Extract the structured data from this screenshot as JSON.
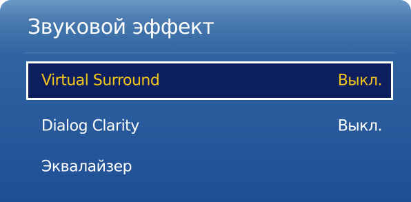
{
  "menu": {
    "title": "Звуковой эффект",
    "items": [
      {
        "label": "Virtual Surround",
        "value": "Выкл.",
        "focused": true
      },
      {
        "label": "Dialog Clarity",
        "value": "Выкл.",
        "focused": false
      },
      {
        "label": "Эквалайзер",
        "value": "",
        "focused": false
      }
    ]
  },
  "colors": {
    "panel_background": "#2a5c9c",
    "focused_background": "#0d1f5e",
    "focused_border": "#ffffff",
    "focused_text": "#f4c51a",
    "text": "#ffffff"
  }
}
